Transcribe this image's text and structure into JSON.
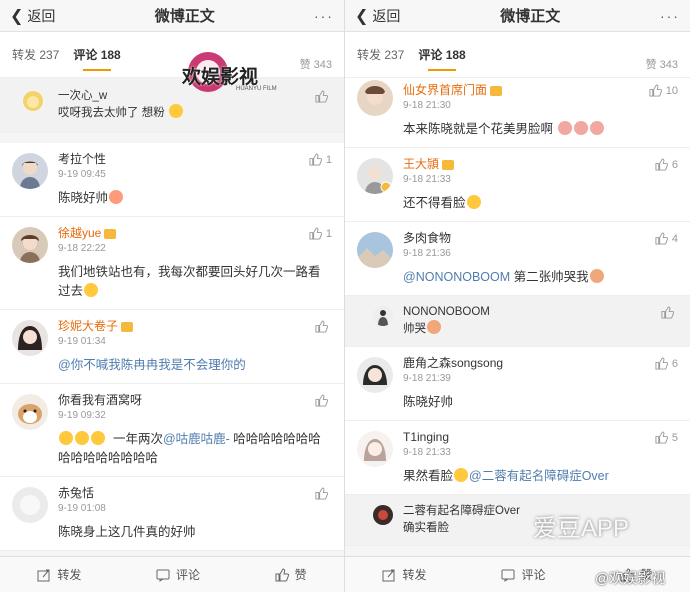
{
  "left": {
    "header": {
      "back_label": "返回",
      "title": "微博正文",
      "more": "···"
    },
    "tabs": {
      "repost": "转发 237",
      "comment": "评论 188",
      "like": "赞 343"
    },
    "top_reply": {
      "name": "一次心_w",
      "text": "哎呀我去太帅了 想粉"
    },
    "comments": [
      {
        "name": "考拉个性",
        "time": "9-19 09:45",
        "text": "陈晓好帅",
        "likes": "1"
      },
      {
        "name": "徐越yue",
        "time": "9-18 22:22",
        "text": "我们地铁站也有，我每次都要回头好几次一路看过去",
        "likes": "1"
      },
      {
        "name": "珍妮大卷子",
        "time": "9-19 01:34",
        "mention": "@你不喊我陈冉冉我是不会理你的",
        "likes": ""
      },
      {
        "name": "你看我有酒窝呀",
        "time": "9-19 09:32",
        "text_pre": "一年两次",
        "mention": "@咕鹿咕鹿-",
        "text_post": " 哈哈哈哈哈哈哈哈哈哈哈哈哈哈哈",
        "likes": ""
      },
      {
        "name": "赤兔恬",
        "time": "9-19 01:08",
        "text": "陈晓身上这几件真的好帅",
        "likes": ""
      }
    ],
    "bottom": {
      "repost": "转发",
      "comment": "评论",
      "like": "赞"
    },
    "watermark": {
      "logo_text": "欢娱影视",
      "logo_sub": "HUANYU FILM"
    }
  },
  "right": {
    "header": {
      "back_label": "返回",
      "title": "微博正文",
      "more": "···"
    },
    "tabs": {
      "repost": "转发 237",
      "comment": "评论 188",
      "like": "赞 343"
    },
    "comments": [
      {
        "name": "仙女界首席门面",
        "time": "9-18 21:30",
        "text": "本来陈晓就是个花美男脸啊",
        "likes": "10"
      },
      {
        "name": "王大頴",
        "time": "9-18 21:33",
        "text": "还不得看脸",
        "likes": "6"
      },
      {
        "name": "多肉食物",
        "time": "9-18 21:36",
        "mention": "@NONONOBOOM",
        "text_post": " 第二张帅哭我",
        "likes": "4"
      },
      {
        "name": "鹿角之森songsong",
        "time": "9-18 21:39",
        "text": "陈晓好帅",
        "likes": "6"
      },
      {
        "name": "T1inging",
        "time": "9-18 21:33",
        "text_pre": "果然看脸",
        "mention": "@二蓉有起名障碍症Over",
        "likes": "5"
      }
    ],
    "replies": [
      {
        "name": "NONONOBOOM",
        "text": "帅哭"
      },
      {
        "name": "二蓉有起名障碍症Over",
        "text": "确实看脸"
      }
    ],
    "bottom": {
      "repost": "转发",
      "comment": "评论",
      "like": "赞"
    },
    "watermark": {
      "app": "爱豆APP",
      "weibo": "@欢娱影视"
    }
  },
  "colors": {
    "accent": "#f39800",
    "name_orange": "#e86b0c",
    "link": "#507daf"
  }
}
